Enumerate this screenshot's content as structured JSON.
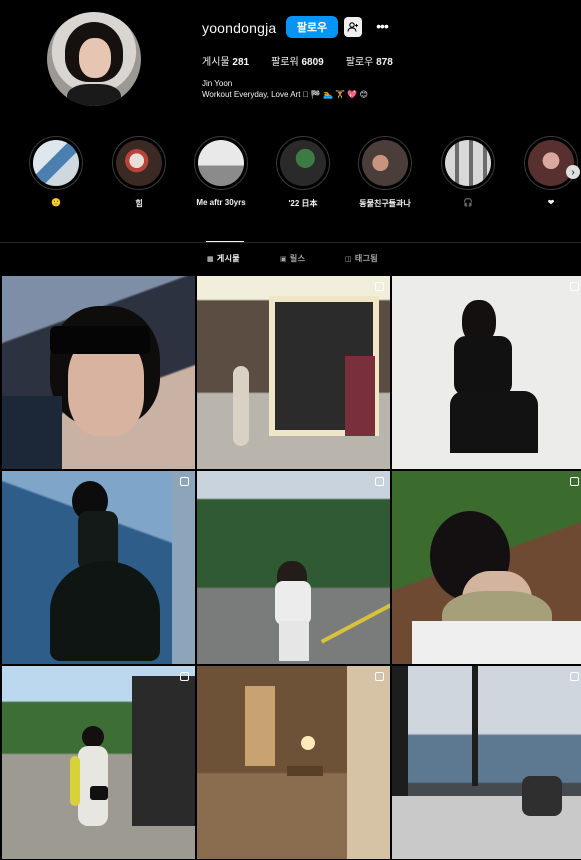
{
  "profile": {
    "username": "yoondongja",
    "follow_label": "팔로우",
    "suggest_icon": "person-add-icon",
    "more_icon": "more-horizontal-icon",
    "full_name": "Jin Yoon",
    "bio": "Workout Everyday, Love Art 🏼 🏁 🏊 🏋 💖 😊"
  },
  "stats": [
    {
      "label": "게시물",
      "value": "281"
    },
    {
      "label": "팔로워",
      "value": "6809"
    },
    {
      "label": "팔로우",
      "value": "878"
    }
  ],
  "highlights": [
    {
      "label": "🙂"
    },
    {
      "label": "힘"
    },
    {
      "label": "Me aftr 30yrs"
    },
    {
      "label": "'22 日本"
    },
    {
      "label": "동물친구들과나"
    },
    {
      "label": "🎧"
    },
    {
      "label": "❤"
    }
  ],
  "tabs": [
    {
      "label": "게시물",
      "icon": "grid-icon",
      "active": true
    },
    {
      "label": "릴스",
      "icon": "reels-icon",
      "active": false
    },
    {
      "label": "태그됨",
      "icon": "tagged-icon",
      "active": false
    }
  ],
  "posts": [
    {
      "subject": "selfie-in-car-sunglasses",
      "multi": false
    },
    {
      "subject": "woman-outside-shop",
      "multi": true
    },
    {
      "subject": "woman-sitting-black-outfit",
      "multi": true
    },
    {
      "subject": "woman-black-dress-blue-wall",
      "multi": true
    },
    {
      "subject": "child-walking-road-mountains",
      "multi": true
    },
    {
      "subject": "woman-ponytail-with-hat",
      "multi": true
    },
    {
      "subject": "woman-walking-street-yellow-bag",
      "multi": true
    },
    {
      "subject": "hotel-hallway-lamp",
      "multi": true
    },
    {
      "subject": "hotel-room-sea-view",
      "multi": true
    }
  ],
  "colors": {
    "accent": "#0095f6",
    "background": "#000000"
  }
}
